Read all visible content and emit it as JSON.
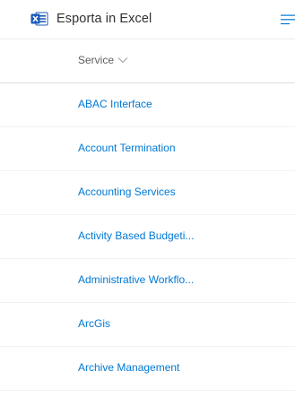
{
  "toolbar": {
    "export_label": "Esporta in Excel",
    "export_icon": "excel-icon",
    "menu_icon": "hamburger-menu-icon"
  },
  "table": {
    "column_header": "Service",
    "column_sort_icon": "chevron-down-icon",
    "rows": [
      {
        "label": "ABAC Interface"
      },
      {
        "label": "Account Termination"
      },
      {
        "label": "Accounting Services"
      },
      {
        "label": "Activity Based Budgeti..."
      },
      {
        "label": "Administrative Workflo..."
      },
      {
        "label": "ArcGis"
      },
      {
        "label": "Archive Management"
      }
    ]
  },
  "colors": {
    "link": "#0078d4",
    "header_text": "#605e5c",
    "toolbar_text": "#323130",
    "excel_green": "#185abd",
    "divider": "#edebe9"
  }
}
